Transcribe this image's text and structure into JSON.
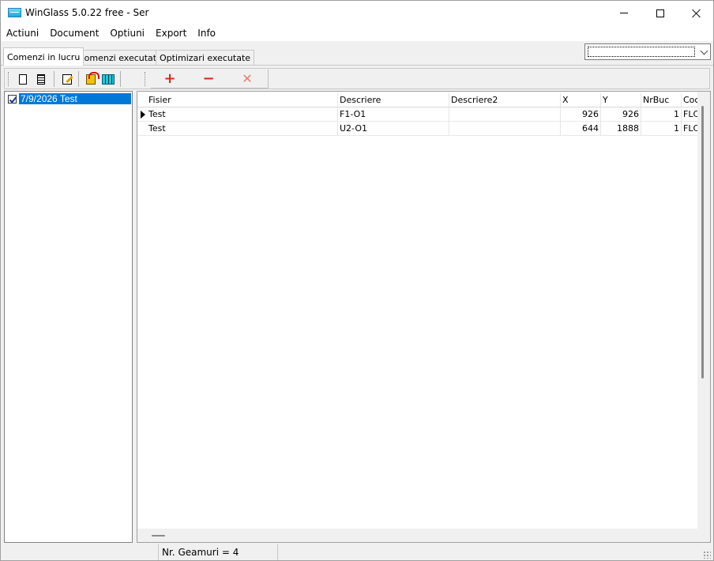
{
  "window": {
    "title": "WinGlass 5.0.22 free - Ser"
  },
  "menu": [
    "Actiuni",
    "Document",
    "Optiuni",
    "Export",
    "Info"
  ],
  "tabs": [
    {
      "label": "Comenzi in lucru",
      "active": true
    },
    {
      "label": "Comenzi executate",
      "active": false
    },
    {
      "label": "Optimizari executate",
      "active": false
    }
  ],
  "combo": {
    "value": ""
  },
  "toolbar": {
    "icons": [
      "new-document-icon",
      "list-document-icon",
      "edit-icon",
      "refresh-icon",
      "grid-icon"
    ],
    "ops": [
      "+",
      "−",
      "✕"
    ]
  },
  "tree": {
    "nodes": [
      {
        "label": "7/9/2026  Test",
        "checked": true
      }
    ]
  },
  "grid": {
    "columns": [
      "Fisier",
      "Descriere",
      "Descriere2",
      "X",
      "Y",
      "NrBuc",
      "Coc"
    ],
    "rows": [
      [
        "Test",
        "F1-O1",
        "",
        "926",
        "926",
        "1",
        "FLC"
      ],
      [
        "Test",
        "U2-O1",
        "",
        "644",
        "1888",
        "1",
        "FLC"
      ]
    ]
  },
  "status": {
    "pane1": "",
    "pane2": "Nr. Geamuri = 4"
  },
  "colors": {
    "selection": "#0078d7",
    "op_red": "#d42a1a"
  }
}
